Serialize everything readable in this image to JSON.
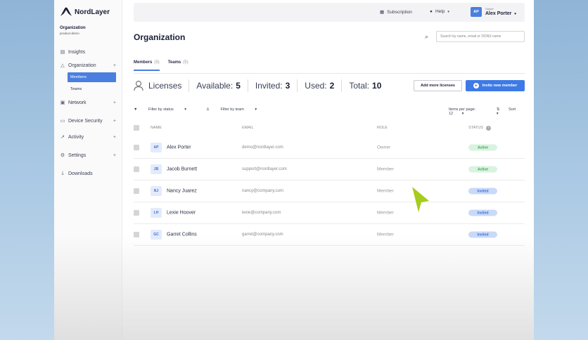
{
  "brand": {
    "name": "NordLayer"
  },
  "org": {
    "name": "Organization",
    "sub": "product-demo"
  },
  "sidebar": {
    "items": [
      {
        "label": "Insights",
        "icon": "chart-icon"
      },
      {
        "label": "Organization",
        "icon": "org-icon",
        "expand": "+"
      },
      {
        "label": "Network",
        "icon": "network-icon",
        "expand": "+"
      },
      {
        "label": "Device Security",
        "icon": "device-icon",
        "expand": "+"
      },
      {
        "label": "Activity",
        "icon": "activity-icon",
        "expand": "+"
      },
      {
        "label": "Settings",
        "icon": "gear-icon",
        "expand": "+"
      },
      {
        "label": "Downloads",
        "icon": "download-icon"
      }
    ],
    "sub": [
      {
        "label": "Members"
      },
      {
        "label": "Teams"
      }
    ]
  },
  "topbar": {
    "subscription": "Subscription",
    "help": "Help",
    "avatar": "AP",
    "owner_label": "Owner",
    "owner_name": "Alex Porter"
  },
  "page": {
    "title": "Organization",
    "search_placeholder": "Search by name, email or DDNS name"
  },
  "tabs": [
    {
      "label": "Members",
      "count": "(5)"
    },
    {
      "label": "Teams",
      "count": "(5)"
    }
  ],
  "licenses": {
    "label": "Licenses",
    "available_label": "Available:",
    "available": "5",
    "invited_label": "Invited:",
    "invited": "3",
    "used_label": "Used:",
    "used": "2",
    "total_label": "Total:",
    "total": "10"
  },
  "buttons": {
    "add": "Add more licenses",
    "invite": "Invite new member"
  },
  "filters": {
    "status": "Filter by status",
    "team": "Filter by team",
    "per_page": "Items per page: 12",
    "sort": "Sort"
  },
  "table": {
    "headers": {
      "name": "NAME",
      "email": "EMAIL",
      "role": "ROLE",
      "status": "STATUS"
    },
    "rows": [
      {
        "initials": "AP",
        "name": "Alex Porter",
        "email": "demo@nordlayer.com",
        "role": "Owner",
        "status": "Active"
      },
      {
        "initials": "JB",
        "name": "Jacob Burnett",
        "email": "support@nordlayer.com",
        "role": "Member",
        "status": "Active"
      },
      {
        "initials": "NJ",
        "name": "Nancy Juarez",
        "email": "nancy@company.com",
        "role": "Member",
        "status": "Invited"
      },
      {
        "initials": "LH",
        "name": "Lexie Hoover",
        "email": "lexie@company.com",
        "role": "Member",
        "status": "Invited"
      },
      {
        "initials": "GC",
        "name": "Garret Collins",
        "email": "garret@company.com",
        "role": "Member",
        "status": "Invited"
      }
    ]
  },
  "colors": {
    "accent": "#3e7ae6",
    "active": "#3aa65a",
    "cursor": "#a6cc1e"
  }
}
